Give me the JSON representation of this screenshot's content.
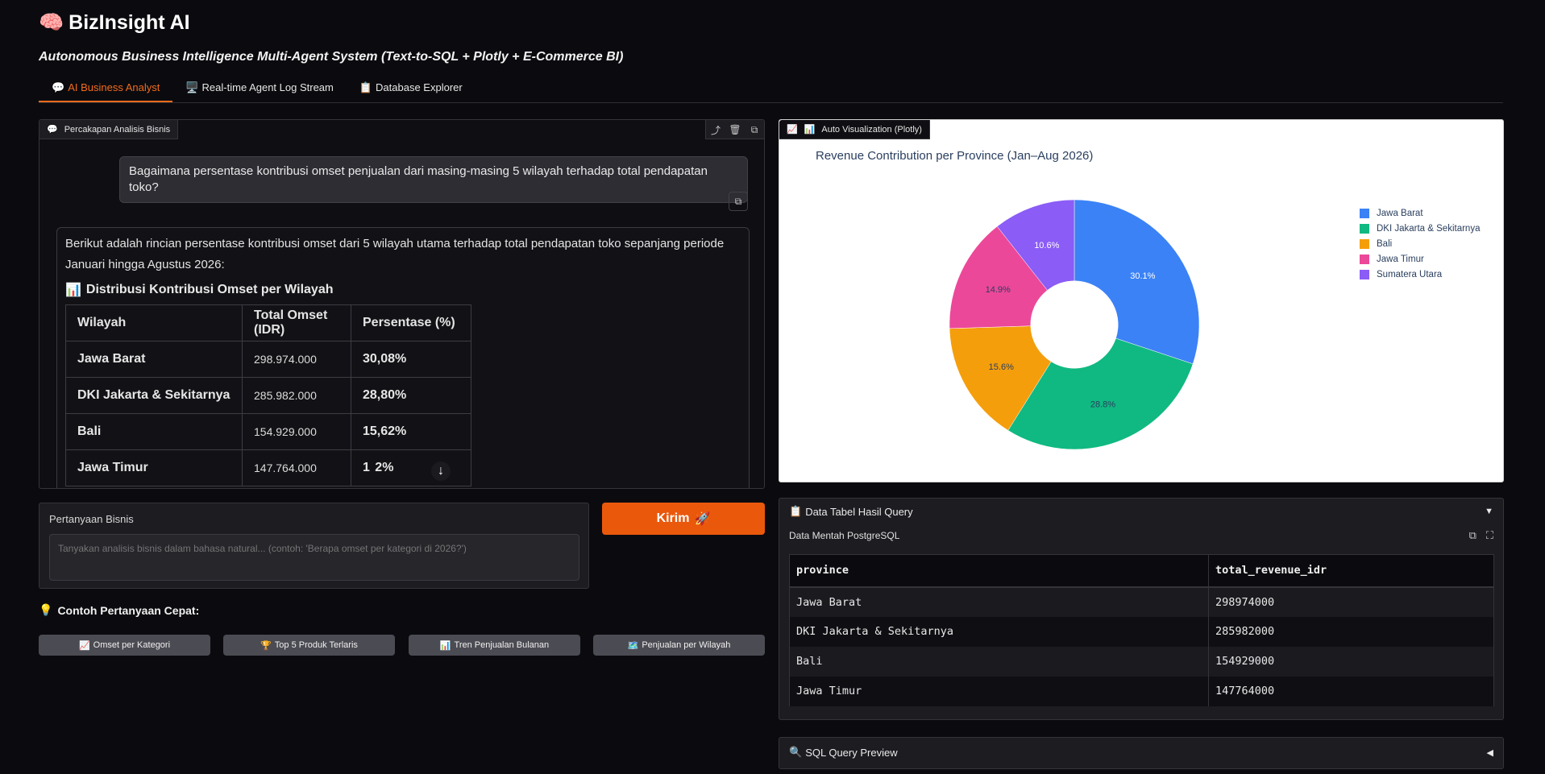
{
  "app": {
    "title": "BizInsight AI",
    "subtitle": "Autonomous Business Intelligence Multi-Agent System (Text-to-SQL + Plotly + E-Commerce BI)"
  },
  "tabs": [
    {
      "label": "AI Business Analyst",
      "icon": "speech-bubble"
    },
    {
      "label": "Real-time Agent Log Stream",
      "icon": "monitor"
    },
    {
      "label": "Database Explorer",
      "icon": "clipboard"
    }
  ],
  "chat": {
    "label": "Percakapan Analisis Bisnis",
    "user_message": "Bagaimana persentase kontribusi omset penjualan dari masing-masing 5 wilayah terhadap total pendapatan toko?",
    "bot_intro": "Berikut adalah rincian persentase kontribusi omset dari 5 wilayah utama terhadap total pendapatan toko sepanjang periode Januari hingga Agustus 2026:",
    "bot_heading": "Distribusi Kontribusi Omset per Wilayah",
    "table_headers": [
      "Wilayah",
      "Total Omset (IDR)",
      "Persentase (%)"
    ],
    "table_rows": [
      [
        "Jawa Barat",
        "298.974.000",
        "30,08%"
      ],
      [
        "DKI Jakarta & Sekitarnya",
        "285.982.000",
        "28,80%"
      ],
      [
        "Bali",
        "154.929.000",
        "15,62%"
      ],
      [
        "Jawa Timur",
        "147.764.000",
        "1  2%"
      ]
    ]
  },
  "question": {
    "label": "Pertanyaan Bisnis",
    "placeholder": "Tanyakan analisis bisnis dalam bahasa natural... (contoh: 'Berapa omset per kategori di 2026?')"
  },
  "send_button": "Kirim",
  "quick": {
    "title": "Contoh Pertanyaan Cepat:",
    "buttons": [
      {
        "label": "Omset per Kategori",
        "icon": "chart-increasing"
      },
      {
        "label": "Top 5 Produk Terlaris",
        "icon": "trophy"
      },
      {
        "label": "Tren Penjualan Bulanan",
        "icon": "bar-chart"
      },
      {
        "label": "Penjualan per Wilayah",
        "icon": "map"
      }
    ]
  },
  "visualization": {
    "label": "Auto Visualization (Plotly)"
  },
  "chart_data": {
    "type": "pie",
    "title": "Revenue Contribution per Province (Jan–Aug 2026)",
    "categories": [
      "Jawa Barat",
      "DKI Jakarta & Sekitarnya",
      "Bali",
      "Jawa Timur",
      "Sumatera Utara"
    ],
    "values": [
      30.1,
      28.8,
      15.6,
      14.9,
      10.6
    ],
    "labels": [
      "30.1%",
      "28.8%",
      "15.6%",
      "14.9%",
      "10.6%"
    ],
    "colors": [
      "#3b82f6",
      "#10b981",
      "#f59e0b",
      "#ec4899",
      "#8b5cf6"
    ],
    "hole": 0.35,
    "legend_position": "top-right",
    "direction": "clockwise"
  },
  "data_panel": {
    "title": "Data Tabel Hasil Query",
    "subtitle": "Data Mentah PostgreSQL",
    "headers": [
      "province",
      "total_revenue_idr"
    ],
    "rows": [
      [
        "Jawa Barat",
        "298974000"
      ],
      [
        "DKI Jakarta & Sekitarnya",
        "285982000"
      ],
      [
        "Bali",
        "154929000"
      ],
      [
        "Jawa Timur",
        "147764000"
      ]
    ]
  },
  "sql_panel": {
    "title": "SQL Query Preview"
  }
}
